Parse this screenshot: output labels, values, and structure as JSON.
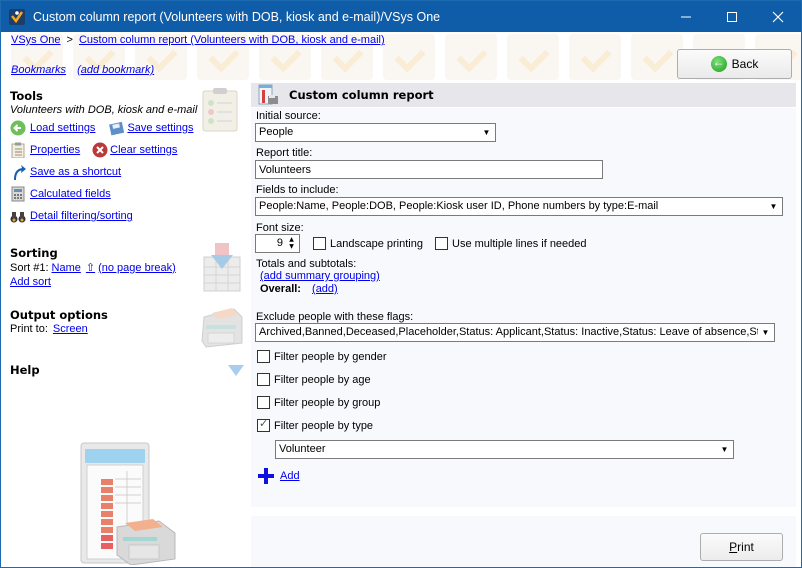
{
  "window": {
    "title": "Custom column report (Volunteers with DOB, kiosk and e-mail)/VSys One",
    "controls": [
      "minimize",
      "maximize",
      "close"
    ]
  },
  "breadcrumb": {
    "items": [
      "VSys One",
      "Custom column report (Volunteers with DOB, kiosk and e-mail)"
    ],
    "separator": ">"
  },
  "bookmarks": {
    "label": "Bookmarks",
    "add_label": "(add bookmark)"
  },
  "back_button": {
    "label": "Back"
  },
  "tools": {
    "title": "Tools",
    "subtitle": "Volunteers with DOB, kiosk and e-mail",
    "items": [
      {
        "label": "Load settings",
        "icon": "green-back-arrow-icon"
      },
      {
        "label": "Save settings",
        "icon": "floppy-disk-icon"
      },
      {
        "label": "Properties",
        "icon": "clipboard-icon"
      },
      {
        "label": "Clear settings",
        "icon": "red-x-icon"
      },
      {
        "label": "Save as a shortcut",
        "icon": "shortcut-arrow-icon"
      },
      {
        "label": "Calculated fields",
        "icon": "calculator-icon"
      },
      {
        "label": "Detail filtering/sorting",
        "icon": "binoculars-icon"
      }
    ]
  },
  "sorting": {
    "title": "Sorting",
    "sort1_label": "Sort #1:",
    "sort1_field": "Name",
    "sort1_direction": "⇧",
    "sort1_break": "(no page break)",
    "add_sort": "Add sort"
  },
  "output": {
    "title": "Output options",
    "print_to_label": "Print to:",
    "print_to_value": "Screen"
  },
  "help": {
    "title": "Help"
  },
  "panel": {
    "title": "Custom column report",
    "initial_source_label": "Initial source:",
    "initial_source_value": "People",
    "report_title_label": "Report title:",
    "report_title_value": "Volunteers",
    "fields_label": "Fields to include:",
    "fields_value": "People:Name, People:DOB, People:Kiosk user ID, Phone numbers by type:E-mail",
    "font_size_label": "Font size:",
    "font_size_value": "9",
    "landscape_label": "Landscape printing",
    "landscape_checked": false,
    "multiline_label": "Use multiple lines if needed",
    "multiline_checked": false,
    "totals_label": "Totals and subtotals:",
    "add_summary_grouping": "(add summary grouping)",
    "overall_label": "Overall:",
    "overall_add": "(add)",
    "exclude_label": "Exclude people with these flags:",
    "exclude_value": "Archived,Banned,Deceased,Placeholder,Status: Applicant,Status: Inactive,Status: Leave of absence,Status: Pending",
    "filters": [
      {
        "label": "Filter people by gender",
        "checked": false
      },
      {
        "label": "Filter people by age",
        "checked": false
      },
      {
        "label": "Filter people by group",
        "checked": false
      },
      {
        "label": "Filter people by type",
        "checked": true
      }
    ],
    "type_value": "Volunteer",
    "add_label": "Add"
  },
  "print_button": {
    "label_underlined": "P",
    "label_rest": "rint"
  }
}
